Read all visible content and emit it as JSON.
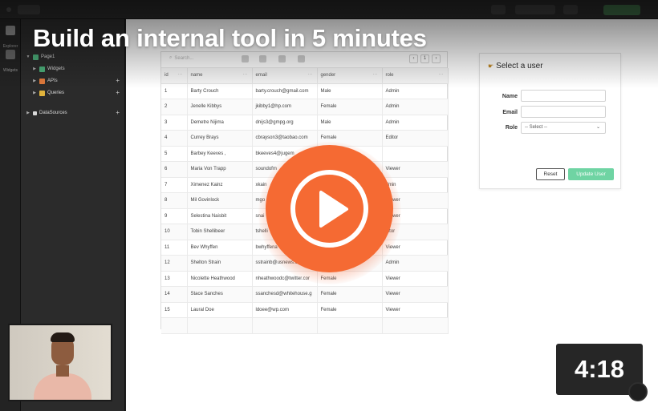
{
  "video": {
    "title": "Build an internal tool in 5 minutes",
    "duration": "4:18"
  },
  "rail": {
    "items": [
      {
        "label": "Explorer",
        "icon": "explorer-icon"
      },
      {
        "label": "Widgets",
        "icon": "widgets-icon"
      }
    ]
  },
  "explorer": {
    "page": "Page1",
    "items": [
      {
        "label": "Widgets",
        "icon": "widgets-icon",
        "color": "#4caf7a"
      },
      {
        "label": "APIs",
        "icon": "api-icon",
        "color": "#e07a3c"
      },
      {
        "label": "Queries",
        "icon": "queries-icon",
        "color": "#e0b33c"
      }
    ],
    "datasources": "DataSources"
  },
  "table": {
    "search_placeholder": "Search...",
    "page_number": "1",
    "columns": [
      "id",
      "name",
      "email",
      "gender",
      "role"
    ],
    "rows": [
      [
        "1",
        "Barty Crouch",
        "barty.crouch@gmail.com",
        "Male",
        "Admin"
      ],
      [
        "2",
        "Jenelle Kibbys",
        "jkibby1@hp.com",
        "Female",
        "Admin"
      ],
      [
        "3",
        "Demetre Nijima",
        "dnijs3@gmpg.org",
        "Male",
        "Admin"
      ],
      [
        "4",
        "Currey Brays",
        "cbrayson3@taobao.com",
        "Female",
        "Editor"
      ],
      [
        "5",
        "Barbey Keeves ,",
        "bkeeves4@jugem",
        "",
        ""
      ],
      [
        "6",
        "Maria Von Trapp",
        "soundofm",
        "",
        "Viewer"
      ],
      [
        "7",
        "Ximenez Kainz",
        "xkain",
        "",
        "dmin"
      ],
      [
        "8",
        "Mil Govinlock",
        "mgo",
        "",
        "Viewer"
      ],
      [
        "9",
        "Selestina Naisbit",
        "snai",
        "",
        "Viewer"
      ],
      [
        "10",
        "Tobin Shellibeer",
        "tshelli",
        "",
        "ditor"
      ],
      [
        "11",
        "Bev Whyffen",
        "bwhyffena",
        "",
        "Viewer"
      ],
      [
        "12",
        "Shelton Strain",
        "sstrainb@usnews.com",
        "",
        "Admin"
      ],
      [
        "13",
        "Nicolette Heathwood",
        "nheathwoodc@twitter.cor",
        "Female",
        "Viewer"
      ],
      [
        "14",
        "Stace Sanches",
        "ssanchesd@whitehouse.g",
        "Female",
        "Viewer"
      ],
      [
        "15",
        "Laural Doe",
        "ldoee@wp.com",
        "Female",
        "Viewer"
      ]
    ]
  },
  "form": {
    "title": "Select a user",
    "name_label": "Name",
    "email_label": "Email",
    "role_label": "Role",
    "role_selected": "-- Select --",
    "reset_label": "Reset",
    "update_label": "Update User"
  },
  "colors": {
    "play": "#f56a33",
    "update_button": "#6fd4a3"
  }
}
